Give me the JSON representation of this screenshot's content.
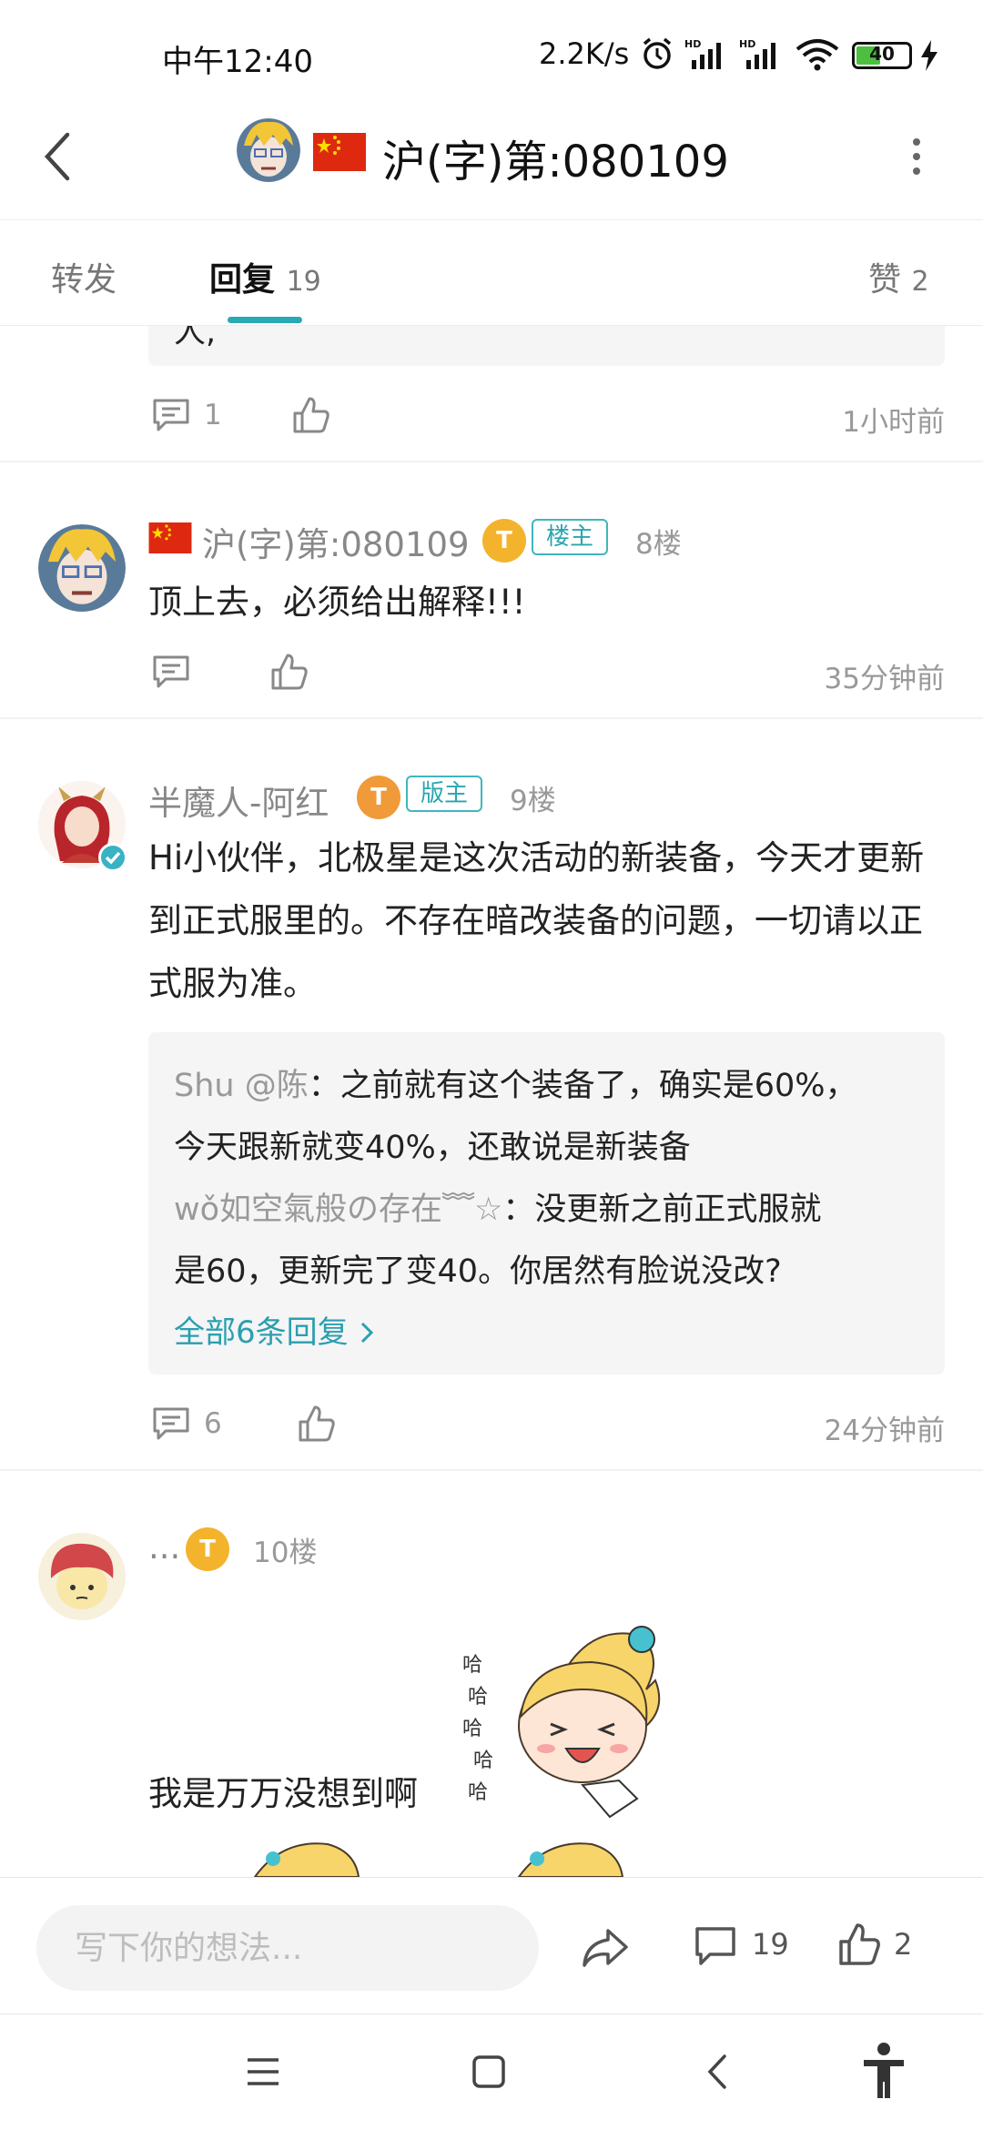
{
  "status_bar": {
    "time": "中午12:40",
    "net_speed": "2.2K/s",
    "battery": "40"
  },
  "header": {
    "title": "沪(字)第:080109",
    "flag": "china-flag-icon",
    "more_icon": "more-vertical-icon",
    "back_icon": "back-arrow-icon"
  },
  "tabs": [
    {
      "label": "转发",
      "count": ""
    },
    {
      "label": "回复",
      "count": "19"
    },
    {
      "label": "赞",
      "count": "2"
    }
  ],
  "prev_post": {
    "comment_count": "1",
    "time": "1小时前",
    "text_fragment": "人,"
  },
  "posts": [
    {
      "name": "沪(字)第:080109",
      "level": "T",
      "role": "楼主",
      "floor": "8楼",
      "content": "顶上去，必须给出解释!!!",
      "comment_count": "",
      "time": "35分钟前"
    },
    {
      "name": "半魔人-阿红",
      "level": "T",
      "role": "版主",
      "floor": "9楼",
      "content": "Hi小伙伴，北极星是这次活动的新装备，今天才更新到正式服里的。不存在暗改装备的问题，一切请以正式服为准。",
      "replies": [
        {
          "name": "Shu @陈",
          "text1": "：之前就有这个装备了，确实是60%，",
          "text2": "今天跟新就变40%，还敢说是新装备"
        },
        {
          "name": "wǒ如空氣般の存在﹌☆",
          "text1": "：没更新之前正式服就",
          "text2": "是60，更新完了变40。你居然有脸说没改?"
        }
      ],
      "more_replies": "全部6条回复",
      "comment_count": "6",
      "time": "24分钟前"
    },
    {
      "name": "...",
      "level": "T",
      "floor": "10楼",
      "content": "我是万万没想到啊"
    }
  ],
  "bottom_bar": {
    "input_placeholder": "写下你的想法...",
    "comment_count": "19",
    "like_count": "2"
  },
  "colors": {
    "accent": "#29a9b3",
    "level_gold": "#f3b32d",
    "level_orange": "#f09a3a"
  }
}
